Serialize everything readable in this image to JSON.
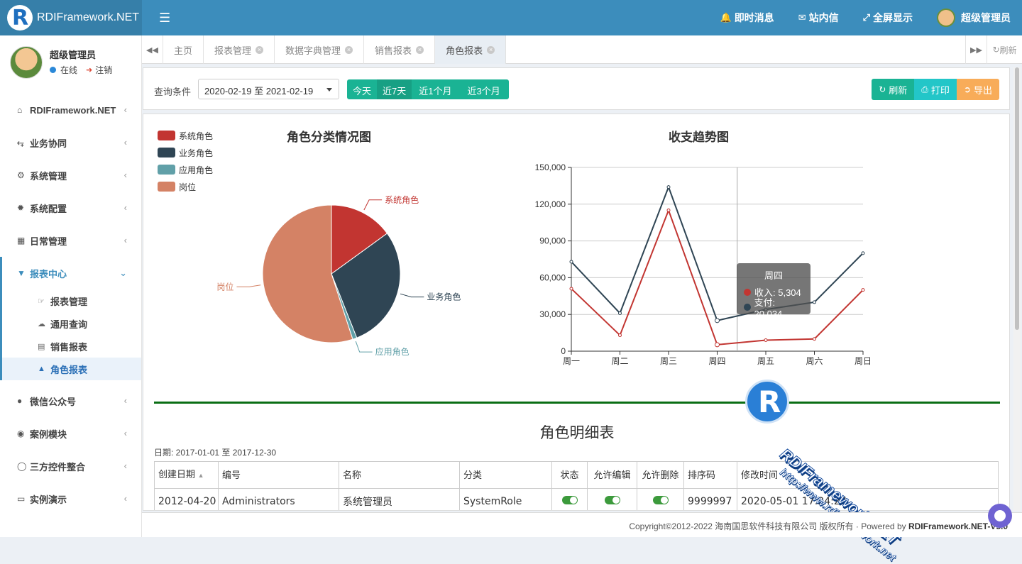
{
  "app": {
    "brand": "RDIFramework.NET"
  },
  "topnav": {
    "instant_msg": "即时消息",
    "inbox": "站内信",
    "fullscreen": "全屏显示",
    "user": "超级管理员"
  },
  "sidebar": {
    "user_name": "超级管理员",
    "status": "在线",
    "logout": "注销",
    "menu_top": [
      {
        "label": "RDIFramework.NET",
        "icon": "home-icon"
      },
      {
        "label": "业务协同",
        "icon": "share-icon"
      },
      {
        "label": "系统管理",
        "icon": "cogs-icon"
      },
      {
        "label": "系统配置",
        "icon": "gear-icon"
      },
      {
        "label": "日常管理",
        "icon": "calendar-icon"
      }
    ],
    "active_menu": {
      "label": "报表中心",
      "icon": "filter-icon"
    },
    "submenu": [
      {
        "label": "报表管理",
        "icon": "hand-icon"
      },
      {
        "label": "通用查询",
        "icon": "cloud-icon"
      },
      {
        "label": "销售报表",
        "icon": "bar-chart-icon"
      },
      {
        "label": "角色报表",
        "icon": "area-chart-icon"
      }
    ],
    "menu_bottom": [
      {
        "label": "微信公众号",
        "icon": "wechat-icon"
      },
      {
        "label": "案例模块",
        "icon": "eye-icon"
      },
      {
        "label": "三方控件整合",
        "icon": "globe-icon"
      },
      {
        "label": "实例演示",
        "icon": "desktop-icon"
      }
    ]
  },
  "tabs": {
    "items": [
      {
        "label": "主页",
        "closable": false
      },
      {
        "label": "报表管理",
        "closable": true
      },
      {
        "label": "数据字典管理",
        "closable": true
      },
      {
        "label": "销售报表",
        "closable": true
      },
      {
        "label": "角色报表",
        "closable": true
      }
    ],
    "refresh": "刷新"
  },
  "toolbar": {
    "query_label": "查询条件",
    "date_range": "2020-02-19 至 2021-02-19",
    "quick": [
      "今天",
      "近7天",
      "近1个月",
      "近3个月"
    ],
    "refresh": "刷新",
    "print": "打印",
    "export": "导出"
  },
  "pie_chart": {
    "title": "角色分类情况图",
    "legend": [
      "系统角色",
      "业务角色",
      "应用角色",
      "岗位"
    ],
    "colors": [
      "#c23531",
      "#2f4554",
      "#61a0a8",
      "#d48265"
    ],
    "chart_data": {
      "type": "pie",
      "categories": [
        "系统角色",
        "业务角色",
        "应用角色",
        "岗位"
      ],
      "values": [
        15,
        29,
        1,
        55
      ]
    }
  },
  "line_chart": {
    "title": "收支趋势图",
    "colors": [
      "#c23531",
      "#2f4554"
    ],
    "chart_data": {
      "type": "line",
      "categories": [
        "周一",
        "周二",
        "周三",
        "周四",
        "周五",
        "周六",
        "周日"
      ],
      "ylim": [
        0,
        150000
      ],
      "yticks": [
        "0",
        "30,000",
        "60,000",
        "90,000",
        "120,000",
        "150,000"
      ],
      "series": [
        {
          "name": "收入",
          "values": [
            51000,
            13000,
            115000,
            5304,
            9000,
            10000,
            50000
          ]
        },
        {
          "name": "支付",
          "values": [
            73000,
            31000,
            134000,
            25000,
            34000,
            40000,
            80000
          ]
        }
      ]
    },
    "tooltip": {
      "title": "周四",
      "rows": [
        {
          "label": "收入: 5,304"
        },
        {
          "label": "支付: 20,034"
        }
      ]
    }
  },
  "table": {
    "title": "角色明细表",
    "date": "日期: 2017-01-01 至 2017-12-30",
    "headers": [
      "创建日期",
      "编号",
      "名称",
      "分类",
      "状态",
      "允许编辑",
      "允许删除",
      "排序码",
      "修改时间"
    ],
    "rows": [
      [
        "2012-04-20",
        "Administrators",
        "系统管理员",
        "SystemRole",
        "on",
        "on",
        "on",
        "9999997",
        "2020-05-01 17:24:27"
      ]
    ]
  },
  "watermark": {
    "line1": "RDIFramework.NET",
    "line2": "http://www.rdiframework.net"
  },
  "footer": {
    "text": "Copyright©2012-2022 海南国思软件科技有限公司 版权所有 · Powered by ",
    "brand": "RDIFramework.NET-V5.0"
  }
}
